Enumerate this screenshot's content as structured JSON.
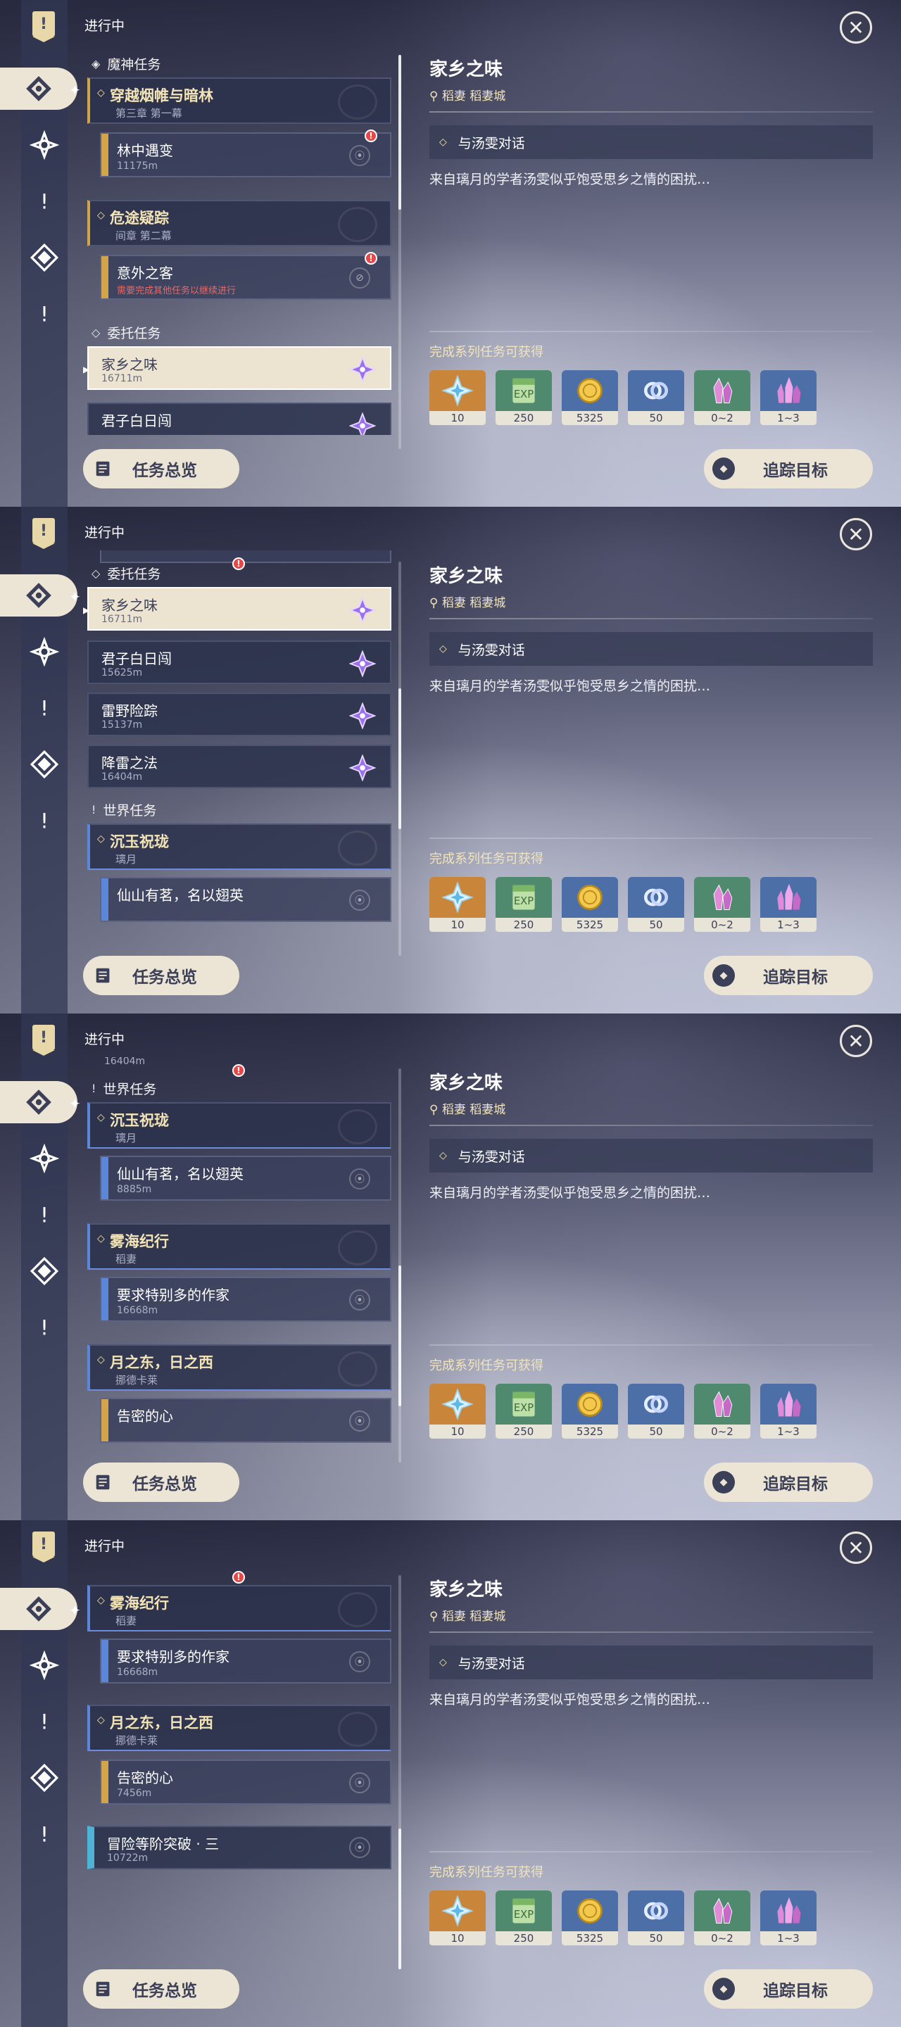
{
  "header": {
    "title": "进行中"
  },
  "sidebar": {
    "icons": [
      "quest-banner-icon",
      "archon-quest-icon",
      "story-quest-icon",
      "world-quest-icon",
      "commission-icon",
      "event-quest-icon"
    ]
  },
  "panels": [
    {
      "list": {
        "sections": [
          {
            "label": "魔神任务"
          },
          {
            "label": "委托任务"
          }
        ],
        "cards": [
          {
            "title": "穿越烟帷与暗林",
            "sub": "第三章 第一幕"
          },
          {
            "title": "林中遇变",
            "sub": "11175m"
          },
          {
            "title": "危途疑踪",
            "sub": "间章 第二幕"
          },
          {
            "title": "意外之客",
            "sub": "需要完成其他任务以继续进行"
          },
          {
            "title": "家乡之味",
            "sub": "16711m"
          },
          {
            "title": "君子白日闯",
            "sub": ""
          }
        ]
      }
    },
    {
      "list": {
        "sections": [
          {
            "label": "委托任务"
          },
          {
            "label": "世界任务"
          }
        ],
        "cards": [
          {
            "title": "家乡之味",
            "sub": "16711m"
          },
          {
            "title": "君子白日闯",
            "sub": "15625m"
          },
          {
            "title": "雷野险踪",
            "sub": "15137m"
          },
          {
            "title": "降雷之法",
            "sub": "16404m"
          },
          {
            "title": "沉玉祝珑",
            "sub": "璃月"
          },
          {
            "title": "仙山有茗，名以翅英",
            "sub": ""
          }
        ]
      }
    },
    {
      "list": {
        "sections": [
          {
            "label": "世界任务"
          }
        ],
        "cards": [
          {
            "title": "",
            "sub": "16404m"
          },
          {
            "title": "沉玉祝珑",
            "sub": "璃月"
          },
          {
            "title": "仙山有茗，名以翅英",
            "sub": "8885m"
          },
          {
            "title": "雾海纪行",
            "sub": "稻妻"
          },
          {
            "title": "要求特别多的作家",
            "sub": "16668m"
          },
          {
            "title": "月之东，日之西",
            "sub": "挪德卡莱"
          },
          {
            "title": "告密的心",
            "sub": ""
          }
        ]
      }
    },
    {
      "list": {
        "sections": [],
        "cards": [
          {
            "title": "雾海纪行",
            "sub": "稻妻"
          },
          {
            "title": "要求特别多的作家",
            "sub": "16668m"
          },
          {
            "title": "月之东，日之西",
            "sub": "挪德卡莱"
          },
          {
            "title": "告密的心",
            "sub": "7456m"
          },
          {
            "title": "冒险等阶突破 · 三",
            "sub": "10722m"
          }
        ]
      }
    }
  ],
  "detail": {
    "title": "家乡之味",
    "location": "稻妻 稻妻城",
    "objective": "与汤雯对话",
    "description": "来自璃月的学者汤雯似乎饱受思乡之情的困扰…",
    "rewards_label": "完成系列任务可获得",
    "rewards": [
      {
        "icon": "primogem-icon",
        "count": "10",
        "bg": "#c9853a"
      },
      {
        "icon": "adventure-exp-icon",
        "count": "250",
        "bg": "#4f8a6e"
      },
      {
        "icon": "mora-icon",
        "count": "5325",
        "bg": "#4c6fa8"
      },
      {
        "icon": "companionship-exp-icon",
        "count": "50",
        "bg": "#4c6fa8"
      },
      {
        "icon": "crystal-chunk-icon",
        "count": "0~2",
        "bg": "#4f8a6e"
      },
      {
        "icon": "crystal-cluster-icon",
        "count": "1~3",
        "bg": "#4c6fa8"
      }
    ]
  },
  "buttons": {
    "overview": "任务总览",
    "track": "追踪目标"
  },
  "colors": {
    "accent_gold": "#d3a54a",
    "accent_blue": "#5c87d8",
    "cream": "#ece5d6",
    "alert_red": "#e54848"
  }
}
